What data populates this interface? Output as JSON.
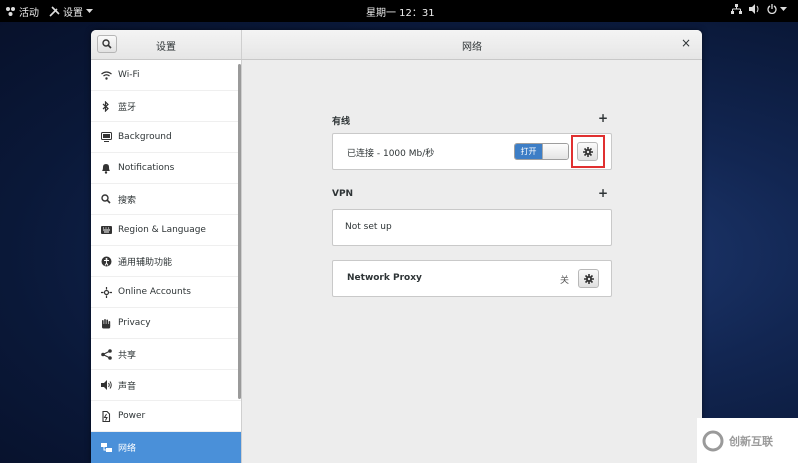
{
  "topbar": {
    "activities": "活动",
    "app_menu": "设置",
    "clock": "星期一 12：31"
  },
  "window": {
    "sidebar_title": "设置",
    "content_title": "网络",
    "close_glyph": "×"
  },
  "sidebar": {
    "items": [
      {
        "label": "Wi-Fi",
        "icon": "wifi-icon"
      },
      {
        "label": "蓝牙",
        "icon": "bluetooth-icon"
      },
      {
        "label": "Background",
        "icon": "background-icon"
      },
      {
        "label": "Notifications",
        "icon": "bell-icon"
      },
      {
        "label": "搜索",
        "icon": "search-icon"
      },
      {
        "label": "Region & Language",
        "icon": "keyboard-icon"
      },
      {
        "label": "通用辅助功能",
        "icon": "accessibility-icon"
      },
      {
        "label": "Online Accounts",
        "icon": "online-accounts-icon"
      },
      {
        "label": "Privacy",
        "icon": "hand-icon"
      },
      {
        "label": "共享",
        "icon": "share-icon"
      },
      {
        "label": "声音",
        "icon": "speaker-icon"
      },
      {
        "label": "Power",
        "icon": "power-icon"
      },
      {
        "label": "网络",
        "icon": "network-icon",
        "selected": true
      }
    ]
  },
  "wired": {
    "heading": "有线",
    "add_glyph": "+",
    "status": "已连接 - 1000 Mb/秒",
    "switch_label": "打开",
    "switch_on": true
  },
  "vpn": {
    "heading": "VPN",
    "add_glyph": "+",
    "status": "Not set up"
  },
  "proxy": {
    "label": "Network Proxy",
    "state": "关"
  },
  "watermark": {
    "text": "创新互联"
  },
  "colors": {
    "accent": "#4a90d9",
    "switch_on": "#3d7ec6",
    "highlight": "#e03030"
  }
}
